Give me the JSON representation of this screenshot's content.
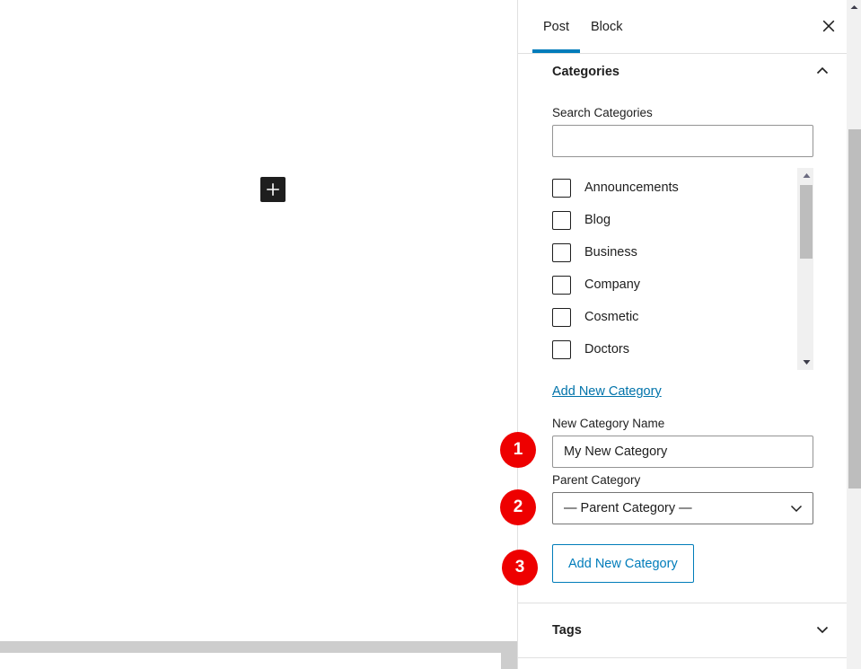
{
  "editor": {
    "inserter_icon": "plus-icon",
    "inserter_label": "Add block"
  },
  "sidebar": {
    "tabs": [
      {
        "label": "Post",
        "active": true
      },
      {
        "label": "Block",
        "active": false
      }
    ],
    "close_icon": "close-icon",
    "sections": [
      {
        "title": "Categories",
        "expanded": true,
        "chevron_icon": "chevron-up-icon"
      },
      {
        "title": "Tags",
        "expanded": false,
        "chevron_icon": "chevron-down-icon"
      }
    ],
    "categories_panel": {
      "search_label": "Search Categories",
      "search_value": "",
      "search_placeholder": "",
      "items": [
        {
          "label": "Announcements",
          "checked": false
        },
        {
          "label": "Blog",
          "checked": false
        },
        {
          "label": "Business",
          "checked": false
        },
        {
          "label": "Company",
          "checked": false
        },
        {
          "label": "Cosmetic",
          "checked": false
        },
        {
          "label": "Doctors",
          "checked": false
        }
      ],
      "add_new_category_link": "Add New Category",
      "new_category_name_label": "New Category Name",
      "new_category_name_value": "My New Category",
      "parent_category_label": "Parent Category",
      "parent_category_value": "— Parent Category —",
      "parent_category_options": [
        "— Parent Category —"
      ],
      "add_new_category_button": "Add New Category",
      "select_chevron_icon": "chevron-down-icon"
    }
  },
  "callouts": [
    {
      "number": "1",
      "target": "new-category-name-input"
    },
    {
      "number": "2",
      "target": "parent-category-select"
    },
    {
      "number": "3",
      "target": "add-new-category-button"
    }
  ],
  "colors": {
    "accent_blue": "#007cba",
    "link_blue": "#0073aa",
    "callout_red": "#ee0000",
    "text": "#1e1e1e",
    "border": "#e0e0e0",
    "input_border": "#949494",
    "scrollbar_thumb": "#bdbdbd",
    "inserter_bg": "#1e1e1e"
  }
}
